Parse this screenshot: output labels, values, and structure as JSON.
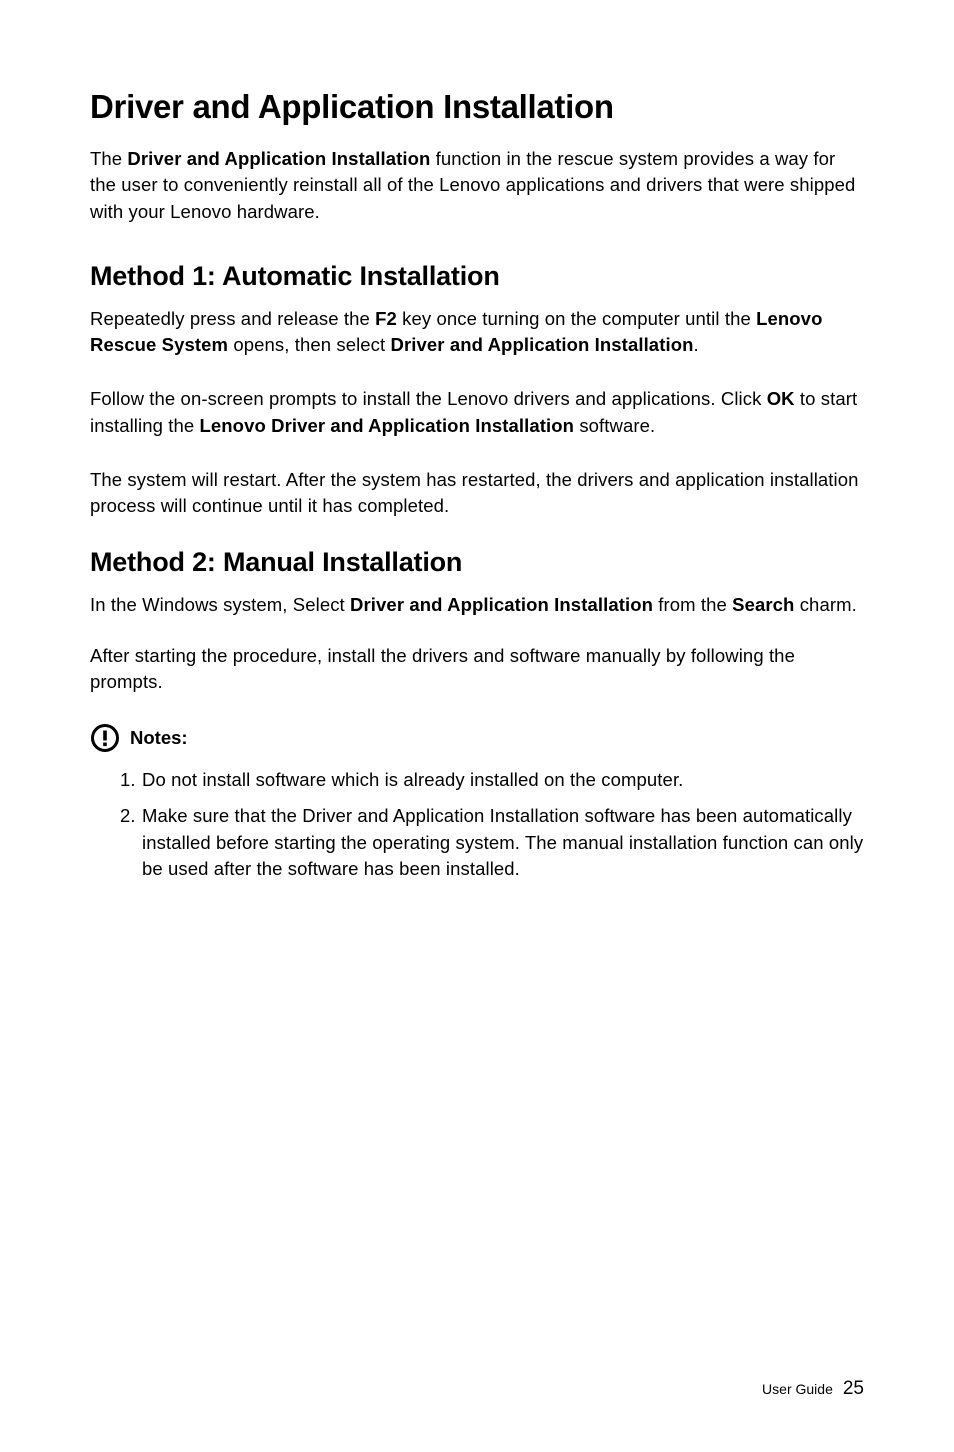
{
  "title": "Driver and Application Installation",
  "intro": {
    "part1": "The ",
    "bold1": "Driver and Application Installation",
    "part2": " function in the rescue system provides a way for the user to conveniently reinstall all of the Lenovo applications and drivers that were shipped with your Lenovo hardware."
  },
  "method1": {
    "heading": "Method 1: Automatic Installation",
    "p1": {
      "t1": "Repeatedly press and release the ",
      "b1": "F2",
      "t2": " key once turning on the computer until the ",
      "b2": "Lenovo Rescue System",
      "t3": " opens, then select ",
      "b3": "Driver and Application Installation",
      "t4": "."
    },
    "p2": {
      "t1": "Follow the on-screen prompts to install the Lenovo drivers and applications. Click ",
      "b1": "OK",
      "t2": " to start installing the ",
      "b2": "Lenovo Driver and Application Installation",
      "t3": " software."
    },
    "p3": "The system will restart. After the system has restarted, the drivers and application installation process will continue until it has completed."
  },
  "method2": {
    "heading": "Method 2: Manual Installation",
    "p1": {
      "t1": "In the Windows system, Select ",
      "b1": "Driver and Application Installation",
      "t2": " from the ",
      "b2": "Search",
      "t3": " charm."
    },
    "p2": "After starting the procedure, install the drivers and software manually by following the prompts."
  },
  "notes": {
    "label": "Notes:",
    "items": [
      "Do not install software which is already installed on the computer.",
      "Make sure that the Driver and Application Installation software has been automatically installed before starting the operating system. The manual installation function can only be used after the software has been installed."
    ]
  },
  "footer": {
    "label": "User Guide",
    "page": "25"
  }
}
